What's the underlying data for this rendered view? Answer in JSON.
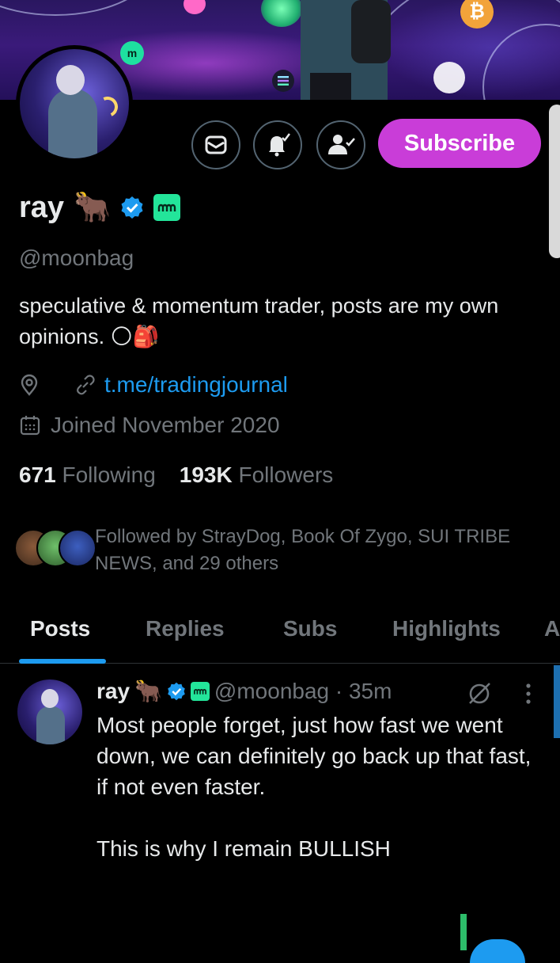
{
  "profile": {
    "name": "ray",
    "name_emoji": "🐂",
    "handle": "@moonbag",
    "bio": "speculative & momentum trader, posts are my own opinions.",
    "bio_emoji": "🌕🎒",
    "link": "t.me/tradingjournal",
    "joined": "Joined November 2020",
    "following_count": "671",
    "following_label": "Following",
    "followers_count": "193K",
    "followers_label": "Followers",
    "followed_by": "Followed by StrayDog, Book Of Zygo, SUI TRIBE NEWS, and 29 others"
  },
  "actions": {
    "subscribe_label": "Subscribe",
    "message_icon": "envelope-icon",
    "notify_icon": "bell-check-icon",
    "follow_icon": "person-check-icon"
  },
  "banner": {
    "coin_btc": "₿",
    "coin_mbx": "m"
  },
  "tabs": [
    {
      "label": "Posts",
      "active": true
    },
    {
      "label": "Replies",
      "active": false
    },
    {
      "label": "Subs",
      "active": false
    },
    {
      "label": "Highlights",
      "active": false
    },
    {
      "label": "A",
      "active": false
    }
  ],
  "post": {
    "name": "ray",
    "name_emoji": "🐂",
    "handle_time": "@moonbag · 35m",
    "text": "Most people forget, just how fast we went down, we can definitely go back up that fast, if not even faster.\n\nThis is why I remain BULLISH"
  },
  "colors": {
    "accent": "#1d9bf0",
    "subscribe": "#c93dd8",
    "muted": "#71767b",
    "badge_green": "#23e59a"
  }
}
